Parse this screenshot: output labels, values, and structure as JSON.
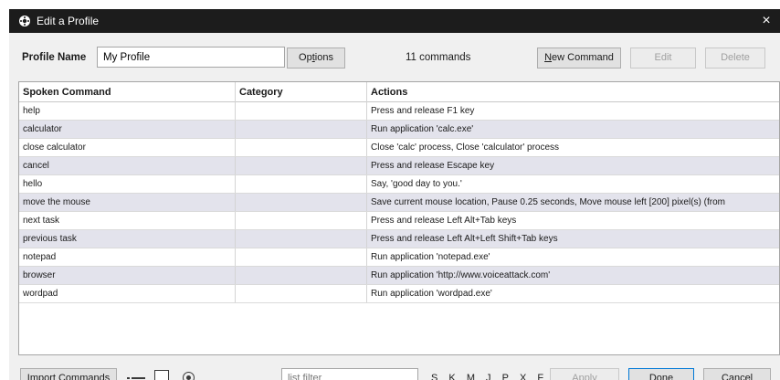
{
  "window": {
    "title": "Edit a Profile",
    "close_glyph": "×"
  },
  "profile": {
    "label": "Profile Name",
    "value": "My Profile"
  },
  "toolbar": {
    "options_pre": "Op",
    "options_key": "t",
    "options_post": "ions",
    "count_text": "11 commands",
    "new_command_key": "N",
    "new_command_post": "ew Command",
    "edit_label": "Edit",
    "delete_label": "Delete"
  },
  "grid": {
    "columns": [
      "Spoken Command",
      "Category",
      "Actions"
    ],
    "rows": [
      {
        "spoken": "help",
        "category": "",
        "actions": "Press and release F1 key"
      },
      {
        "spoken": "calculator",
        "category": "",
        "actions": "Run application 'calc.exe'"
      },
      {
        "spoken": "close calculator",
        "category": "",
        "actions": "Close 'calc' process, Close 'calculator' process"
      },
      {
        "spoken": "cancel",
        "category": "",
        "actions": "Press and release Escape key"
      },
      {
        "spoken": "hello",
        "category": "",
        "actions": "Say, 'good day to you.'"
      },
      {
        "spoken": "move the mouse",
        "category": "",
        "actions": "Save current mouse location, Pause 0.25 seconds, Move mouse left [200] pixel(s) (from"
      },
      {
        "spoken": "next task",
        "category": "",
        "actions": "Press and release Left Alt+Tab keys"
      },
      {
        "spoken": "previous task",
        "category": "",
        "actions": "Press and release Left Alt+Left Shift+Tab keys"
      },
      {
        "spoken": "notepad",
        "category": "",
        "actions": "Run application 'notepad.exe'"
      },
      {
        "spoken": "browser",
        "category": "",
        "actions": "Run application 'http://www.voiceattack.com'"
      },
      {
        "spoken": "wordpad",
        "category": "",
        "actions": "Run application 'wordpad.exe'"
      }
    ]
  },
  "footer": {
    "import_key": "I",
    "import_post": "mport Commands",
    "filter_placeholder": "list filter",
    "letters": [
      "S",
      "K",
      "M",
      "J",
      "P",
      "X",
      "F"
    ],
    "apply_label": "Apply",
    "done_pre": "D",
    "done_key": "o",
    "done_post": "ne",
    "cancel_key": "C",
    "cancel_post": "ancel"
  },
  "icons": {
    "app": "voiceattack-gear-icon",
    "collapse": "dash-line-icon",
    "square": "square-icon",
    "radio": "radio-icon"
  }
}
